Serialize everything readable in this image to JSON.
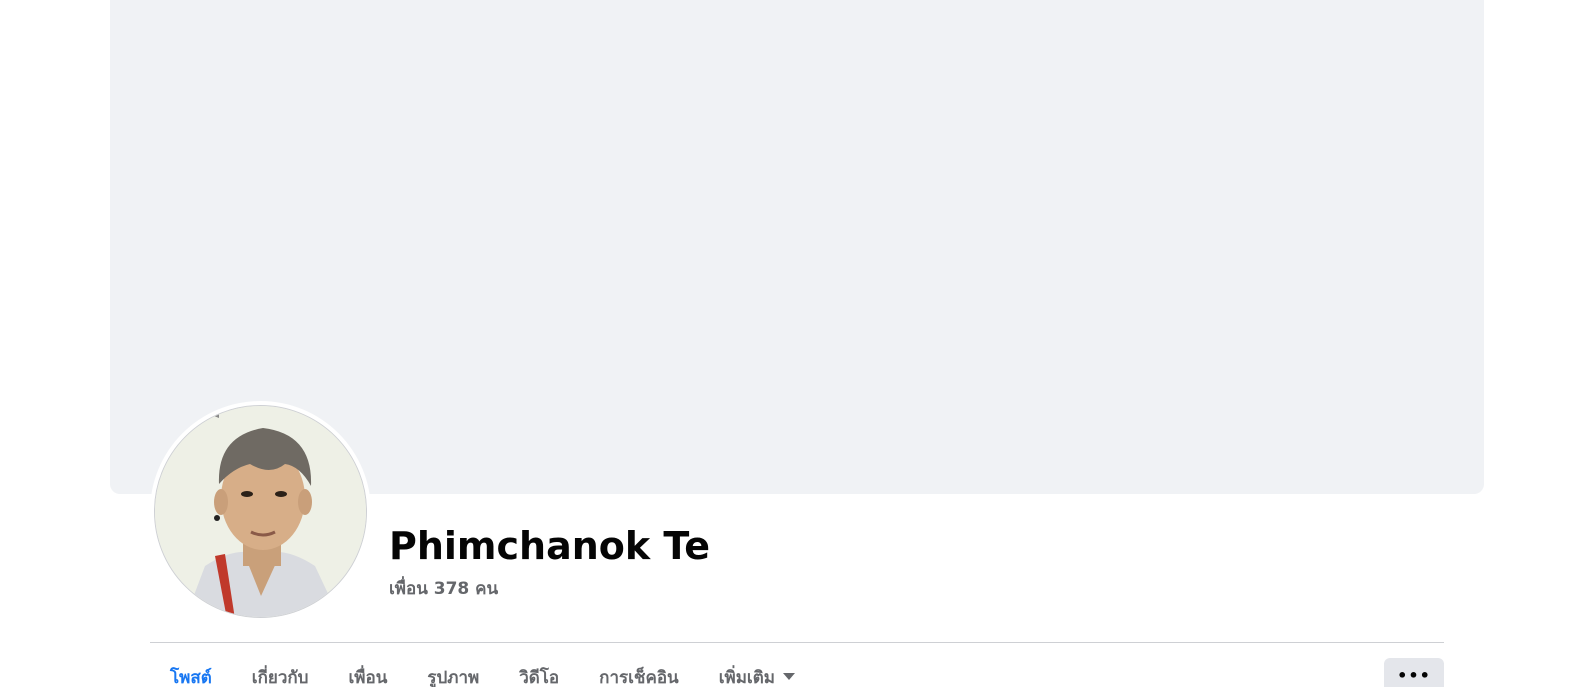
{
  "profile": {
    "name": "Phimchanok Te",
    "friends_text": "เพื่อน 378 คน"
  },
  "tabs": [
    {
      "label": "โพสต์",
      "active": true
    },
    {
      "label": "เกี่ยวกับ",
      "active": false
    },
    {
      "label": "เพื่อน",
      "active": false
    },
    {
      "label": "รูปภาพ",
      "active": false
    },
    {
      "label": "วิดีโอ",
      "active": false
    },
    {
      "label": "การเช็คอิน",
      "active": false
    },
    {
      "label": "เพิ่มเติม",
      "active": false
    }
  ],
  "more_button": {
    "label": "•••"
  },
  "colors": {
    "accent": "#1877f2",
    "cover_bg": "#f0f2f5",
    "secondary_text": "#65676b",
    "button_bg": "#e4e6eb"
  }
}
